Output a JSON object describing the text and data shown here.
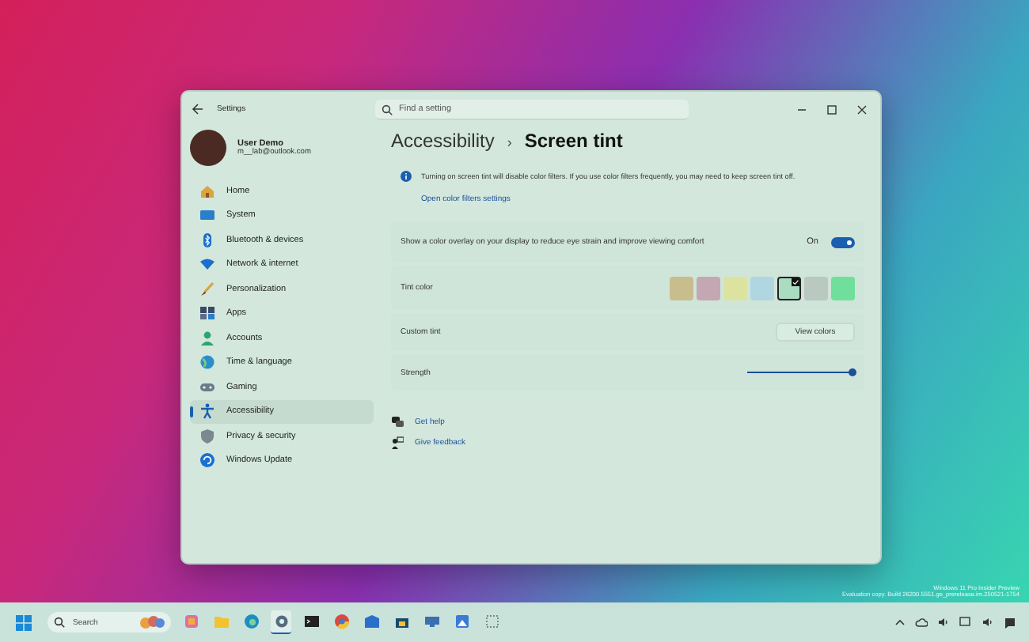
{
  "window": {
    "title": "Settings",
    "search": {
      "placeholder": "Find a setting"
    }
  },
  "user": {
    "name": "User Demo",
    "email": "m__lab@outlook.com"
  },
  "sidebar": {
    "items": [
      {
        "label": "Home",
        "selected": false
      },
      {
        "label": "System",
        "selected": false
      },
      {
        "label": "Bluetooth & devices",
        "selected": false
      },
      {
        "label": "Network & internet",
        "selected": false
      },
      {
        "label": "Personalization",
        "selected": false
      },
      {
        "label": "Apps",
        "selected": false
      },
      {
        "label": "Accounts",
        "selected": false
      },
      {
        "label": "Time & language",
        "selected": false
      },
      {
        "label": "Gaming",
        "selected": false
      },
      {
        "label": "Accessibility",
        "selected": true
      },
      {
        "label": "Privacy & security",
        "selected": false
      },
      {
        "label": "Windows Update",
        "selected": false
      }
    ]
  },
  "breadcrumb": {
    "parent": "Accessibility",
    "separator": "›",
    "current": "Screen tint"
  },
  "info": {
    "text": "Turning on screen tint will disable color filters. If you use color filters frequently, you may need to keep screen tint off.",
    "link": "Open color filters settings"
  },
  "settings": [
    {
      "kind": "toggle",
      "label": "Show a color overlay on your display to reduce eye strain and improve viewing comfort",
      "state_label": "On",
      "on": true
    },
    {
      "kind": "swatches",
      "label": "Tint color",
      "swatches": [
        {
          "color": "#c8bd8c",
          "selected": false
        },
        {
          "color": "#c3a8b4",
          "selected": false
        },
        {
          "color": "#dbe39f",
          "selected": false
        },
        {
          "color": "#afd6e1",
          "selected": false
        },
        {
          "color": "#a9dcc1",
          "selected": true
        },
        {
          "color": "#b9c9c2",
          "selected": false
        },
        {
          "color": "#6fdf9b",
          "selected": false
        }
      ]
    },
    {
      "kind": "button",
      "label": "Custom tint",
      "button": "View colors"
    },
    {
      "kind": "slider",
      "label": "Strength",
      "level": 1
    }
  ],
  "help_links": [
    "Get help",
    "Give feedback"
  ],
  "taskbar": {
    "search_placeholder": "Search",
    "apps": [
      {
        "active": false
      },
      {
        "active": false
      },
      {
        "active": false
      },
      {
        "active": true
      },
      {
        "active": false
      },
      {
        "active": false
      },
      {
        "active": false
      },
      {
        "active": false
      },
      {
        "active": false
      },
      {
        "active": false
      },
      {
        "active": false
      }
    ]
  },
  "watermark_os": [
    "Windows 11 Pro Insider Preview",
    "Evaluation copy. Build 26200.5551.ge_prerelease.im.250521-1754"
  ]
}
